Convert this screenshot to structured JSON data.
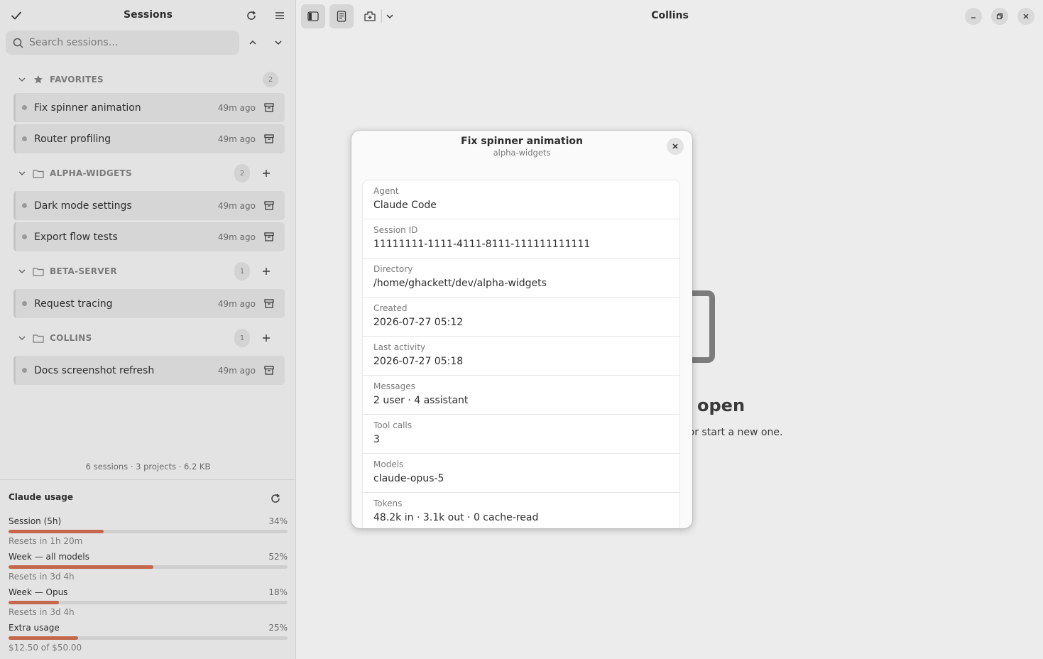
{
  "sidebar": {
    "title": "Sessions",
    "search_placeholder": "Search sessions…",
    "groups": [
      {
        "name": "FAVORITES",
        "count": "2",
        "icon": "star-icon",
        "sessions": [
          {
            "name": "Fix spinner animation",
            "time": "49m ago"
          },
          {
            "name": "Router profiling",
            "time": "49m ago"
          }
        ]
      },
      {
        "name": "ALPHA-WIDGETS",
        "count": "2",
        "icon": "folder-icon",
        "sessions": [
          {
            "name": "Dark mode settings",
            "time": "49m ago"
          },
          {
            "name": "Export flow tests",
            "time": "49m ago"
          }
        ]
      },
      {
        "name": "BETA-SERVER",
        "count": "1",
        "icon": "folder-icon",
        "sessions": [
          {
            "name": "Request tracing",
            "time": "49m ago"
          }
        ]
      },
      {
        "name": "COLLINS",
        "count": "1",
        "icon": "folder-icon",
        "sessions": [
          {
            "name": "Docs screenshot refresh",
            "time": "49m ago"
          }
        ]
      }
    ],
    "stats": "6 sessions · 3 projects · 6.2 KB"
  },
  "usage": {
    "title": "Claude usage",
    "meters": [
      {
        "label": "Session (5h)",
        "percent_text": "34%",
        "fraction": 0.34,
        "note": "Resets in 1h 20m"
      },
      {
        "label": "Week — all models",
        "percent_text": "52%",
        "fraction": 0.52,
        "note": "Resets in 3d 4h"
      },
      {
        "label": "Week — Opus",
        "percent_text": "18%",
        "fraction": 0.18,
        "note": "Resets in 3d 4h"
      },
      {
        "label": "Extra usage",
        "percent_text": "25%",
        "fraction": 0.25,
        "note": "$12.50 of $50.00"
      }
    ],
    "bar_color": "#c4684d"
  },
  "main": {
    "title": "Collins",
    "background": {
      "title_fragment": "open",
      "subtitle_fragment": "r, or start a new one."
    }
  },
  "dialog": {
    "title": "Fix spinner animation",
    "subtitle": "alpha-widgets",
    "properties": [
      {
        "label": "Agent",
        "value": "Claude Code"
      },
      {
        "label": "Session ID",
        "value": "11111111-1111-4111-8111-111111111111"
      },
      {
        "label": "Directory",
        "value": "/home/ghackett/dev/alpha-widgets"
      },
      {
        "label": "Created",
        "value": "2026-07-27 05:12"
      },
      {
        "label": "Last activity",
        "value": "2026-07-27 05:18"
      },
      {
        "label": "Messages",
        "value": "2 user · 4 assistant"
      },
      {
        "label": "Tool calls",
        "value": "3"
      },
      {
        "label": "Models",
        "value": "claude-opus-5"
      },
      {
        "label": "Tokens",
        "value": "48.2k in · 3.1k out · 0 cache-read"
      }
    ]
  }
}
